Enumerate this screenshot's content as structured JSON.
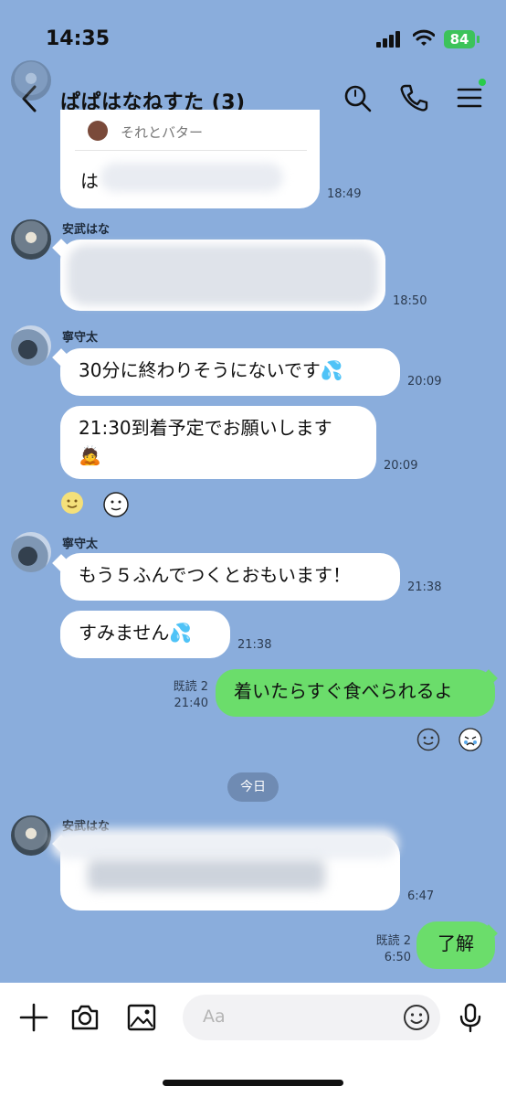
{
  "status_bar": {
    "time": "14:35",
    "battery": "84"
  },
  "header": {
    "title": "ぱぱはなねすた (3)"
  },
  "reply_preview": {
    "quoted_text": "それとバター",
    "partial_text": "は",
    "time": "18:49"
  },
  "messages": [
    {
      "sender": "安武はな",
      "text": "",
      "time": "18:50"
    },
    {
      "sender": "寧守太",
      "text": "30分に終わりそうにないです💦",
      "time": "20:09"
    },
    {
      "sender": "",
      "text": "21:30到着予定でお願いします",
      "emoji": "🙇",
      "time": "20:09"
    },
    {
      "sender": "寧守太",
      "text": "もう５ふんでつくとおもいます！",
      "time": "21:38"
    },
    {
      "sender": "",
      "text": "すみません💦",
      "time": "21:38"
    },
    {
      "sender": "me",
      "text": "着いたらすぐ食べられるよ",
      "read": "既読 2",
      "time": "21:40"
    },
    {
      "sender": "安武はな",
      "text": "",
      "time": "6:47"
    },
    {
      "sender": "me",
      "text": "了解",
      "read": "既読 2",
      "time": "6:50"
    }
  ],
  "date_chip": "今日",
  "input": {
    "placeholder": "Aa"
  },
  "icons": [
    "back-chevron-icon",
    "search-icon",
    "phone-icon",
    "menu-icon",
    "plus-icon",
    "camera-icon",
    "image-icon",
    "emoji-icon",
    "mic-icon"
  ],
  "colors": {
    "background": "#8aaddc",
    "my_bubble": "#6bdd6b",
    "battery": "#3cc35a"
  }
}
